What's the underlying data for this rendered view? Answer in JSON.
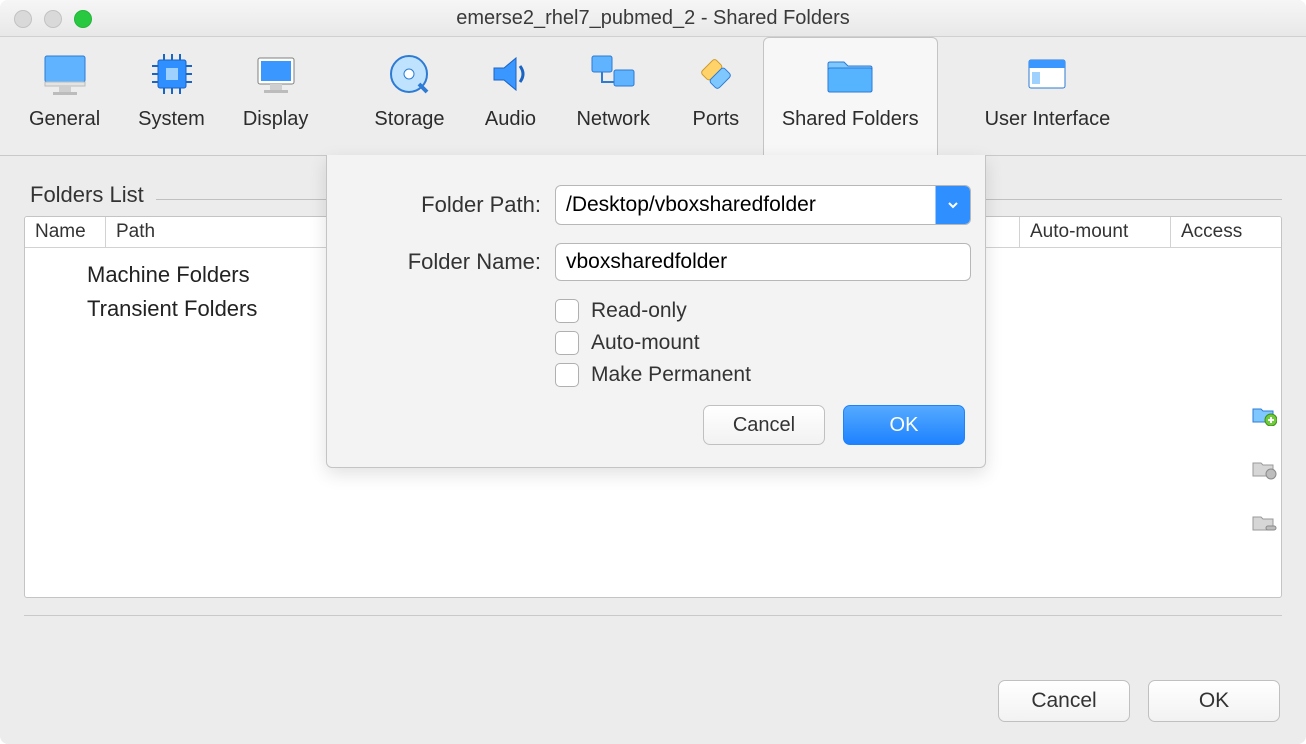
{
  "window_title": "emerse2_rhel7_pubmed_2 - Shared Folders",
  "tabs": {
    "general": "General",
    "system": "System",
    "display": "Display",
    "storage": "Storage",
    "audio": "Audio",
    "network": "Network",
    "ports": "Ports",
    "shared": "Shared Folders",
    "ui": "User Interface"
  },
  "section_title": "Folders List",
  "columns": {
    "name": "Name",
    "path": "Path",
    "automount": "Auto-mount",
    "access": "Access"
  },
  "tree": {
    "machine": "Machine Folders",
    "transient": "Transient Folders"
  },
  "panel": {
    "folder_path_label": "Folder Path:",
    "folder_path_value": "/Desktop/vboxsharedfolder",
    "folder_name_label": "Folder Name:",
    "folder_name_value": "vboxsharedfolder",
    "readonly": "Read-only",
    "automount": "Auto-mount",
    "permanent": "Make Permanent",
    "cancel": "Cancel",
    "ok": "OK"
  },
  "footer": {
    "cancel": "Cancel",
    "ok": "OK"
  }
}
